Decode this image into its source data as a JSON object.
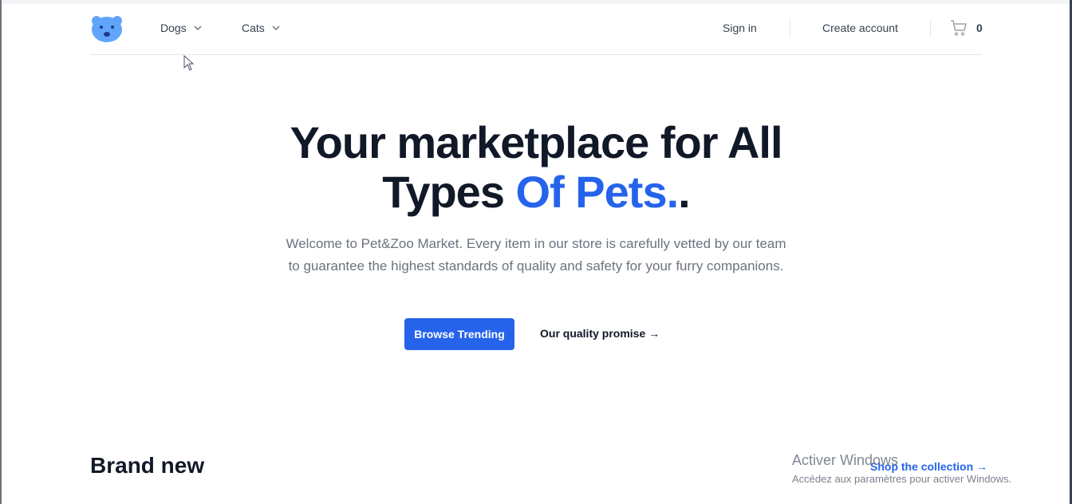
{
  "nav": {
    "dogs_label": "Dogs",
    "cats_label": "Cats",
    "signin_label": "Sign in",
    "create_account_label": "Create account",
    "cart_count": "0"
  },
  "hero": {
    "title_part1": "Your marketplace for All",
    "title_part2": "Types",
    "title_accent": "Of Pets.",
    "title_end": ".",
    "subtitle": "Welcome to Pet&Zoo Market. Every item in our store is carefully vetted by our team to guarantee the highest standards of quality and safety for your furry companions.",
    "browse_label": "Browse Trending",
    "quality_label": "Our quality promise →"
  },
  "section": {
    "heading": "Brand new",
    "shop_link": "Shop the collection →"
  },
  "watermark": {
    "title": "Activer Windows",
    "subtitle": "Accédez aux paramètres pour activer Windows."
  },
  "colors": {
    "accent": "#2563eb",
    "text": "#111827",
    "muted": "#6b7280",
    "logo": "#60a5fa"
  },
  "icons": {
    "logo": "bear-face-logo",
    "dropdown": "chevron-down-icon",
    "cart": "shopping-cart-icon",
    "cursor": "mouse-pointer-icon"
  }
}
